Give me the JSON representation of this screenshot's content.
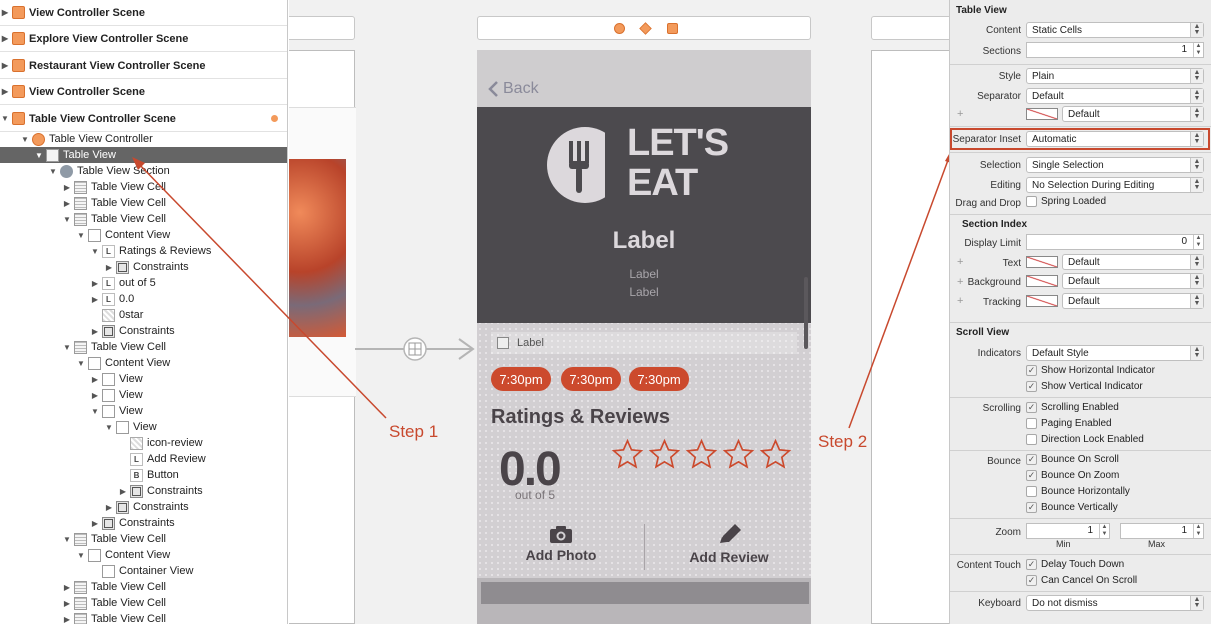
{
  "outline": {
    "scenes": [
      {
        "label": "View Controller Scene"
      },
      {
        "label": "Explore View Controller Scene"
      },
      {
        "label": "Restaurant View Controller Scene"
      },
      {
        "label": "View Controller Scene"
      },
      {
        "label": "Table View Controller Scene"
      }
    ],
    "tree": [
      {
        "label": "Table View Controller"
      },
      {
        "label": "Table View"
      },
      {
        "label": "Table View Section"
      },
      {
        "label": "Table View Cell"
      },
      {
        "label": "Table View Cell"
      },
      {
        "label": "Table View Cell"
      },
      {
        "label": "Content View"
      },
      {
        "label": "Ratings & Reviews"
      },
      {
        "label": "Constraints"
      },
      {
        "label": "out of 5"
      },
      {
        "label": "0.0"
      },
      {
        "label": "0star"
      },
      {
        "label": "Constraints"
      },
      {
        "label": "Table View Cell"
      },
      {
        "label": "Content View"
      },
      {
        "label": "View"
      },
      {
        "label": "View"
      },
      {
        "label": "View"
      },
      {
        "label": "View"
      },
      {
        "label": "icon-review"
      },
      {
        "label": "Add Review"
      },
      {
        "label": "Button"
      },
      {
        "label": "Constraints"
      },
      {
        "label": "Constraints"
      },
      {
        "label": "Constraints"
      },
      {
        "label": "Table View Cell"
      },
      {
        "label": "Content View"
      },
      {
        "label": "Container View"
      },
      {
        "label": "Table View Cell"
      },
      {
        "label": "Table View Cell"
      },
      {
        "label": "Table View Cell"
      }
    ]
  },
  "phone": {
    "back_label": "Back",
    "logo_line1": "LET'S",
    "logo_line2": "EAT",
    "header_label": "Label",
    "header_sub1": "Label",
    "header_sub2": "Label",
    "image_label": "Label",
    "times": [
      "7:30pm",
      "7:30pm",
      "7:30pm"
    ],
    "ratings_title": "Ratings & Reviews",
    "score": "0.0",
    "out_of": "out of 5",
    "add_photo": "Add Photo",
    "add_review": "Add Review"
  },
  "annotations": {
    "step1": "Step 1",
    "step2": "Step 2",
    "color": "#c8492e"
  },
  "inspector": {
    "table_view_title": "Table View",
    "content_label": "Content",
    "content_value": "Static Cells",
    "sections_label": "Sections",
    "sections_value": "1",
    "style_label": "Style",
    "style_value": "Plain",
    "separator_label": "Separator",
    "separator_value": "Default",
    "separator_color_value": "Default",
    "separator_inset_label": "Separator Inset",
    "separator_inset_value": "Automatic",
    "selection_label": "Selection",
    "selection_value": "Single Selection",
    "editing_label": "Editing",
    "editing_value": "No Selection During Editing",
    "dragdrop_label": "Drag and Drop",
    "dragdrop_value": "Spring Loaded",
    "section_index_title": "Section Index",
    "display_limit_label": "Display Limit",
    "display_limit_value": "0",
    "text_label": "Text",
    "text_value": "Default",
    "background_label": "Background",
    "background_value": "Default",
    "tracking_label": "Tracking",
    "tracking_value": "Default",
    "scroll_view_title": "Scroll View",
    "indicators_label": "Indicators",
    "indicators_value": "Default Style",
    "show_h": "Show Horizontal Indicator",
    "show_v": "Show Vertical Indicator",
    "scrolling_label": "Scrolling",
    "scrolling_enabled": "Scrolling Enabled",
    "paging_enabled": "Paging Enabled",
    "direction_lock": "Direction Lock Enabled",
    "bounce_label": "Bounce",
    "bounce_on_scroll": "Bounce On Scroll",
    "bounce_on_zoom": "Bounce On Zoom",
    "bounce_h": "Bounce Horizontally",
    "bounce_v": "Bounce Vertically",
    "zoom_label": "Zoom",
    "zoom_min_value": "1",
    "zoom_max_value": "1",
    "min_label": "Min",
    "max_label": "Max",
    "content_touch_label": "Content Touch",
    "delay_touch": "Delay Touch Down",
    "cancel_scroll": "Can Cancel On Scroll",
    "keyboard_label": "Keyboard",
    "keyboard_value": "Do not dismiss"
  }
}
